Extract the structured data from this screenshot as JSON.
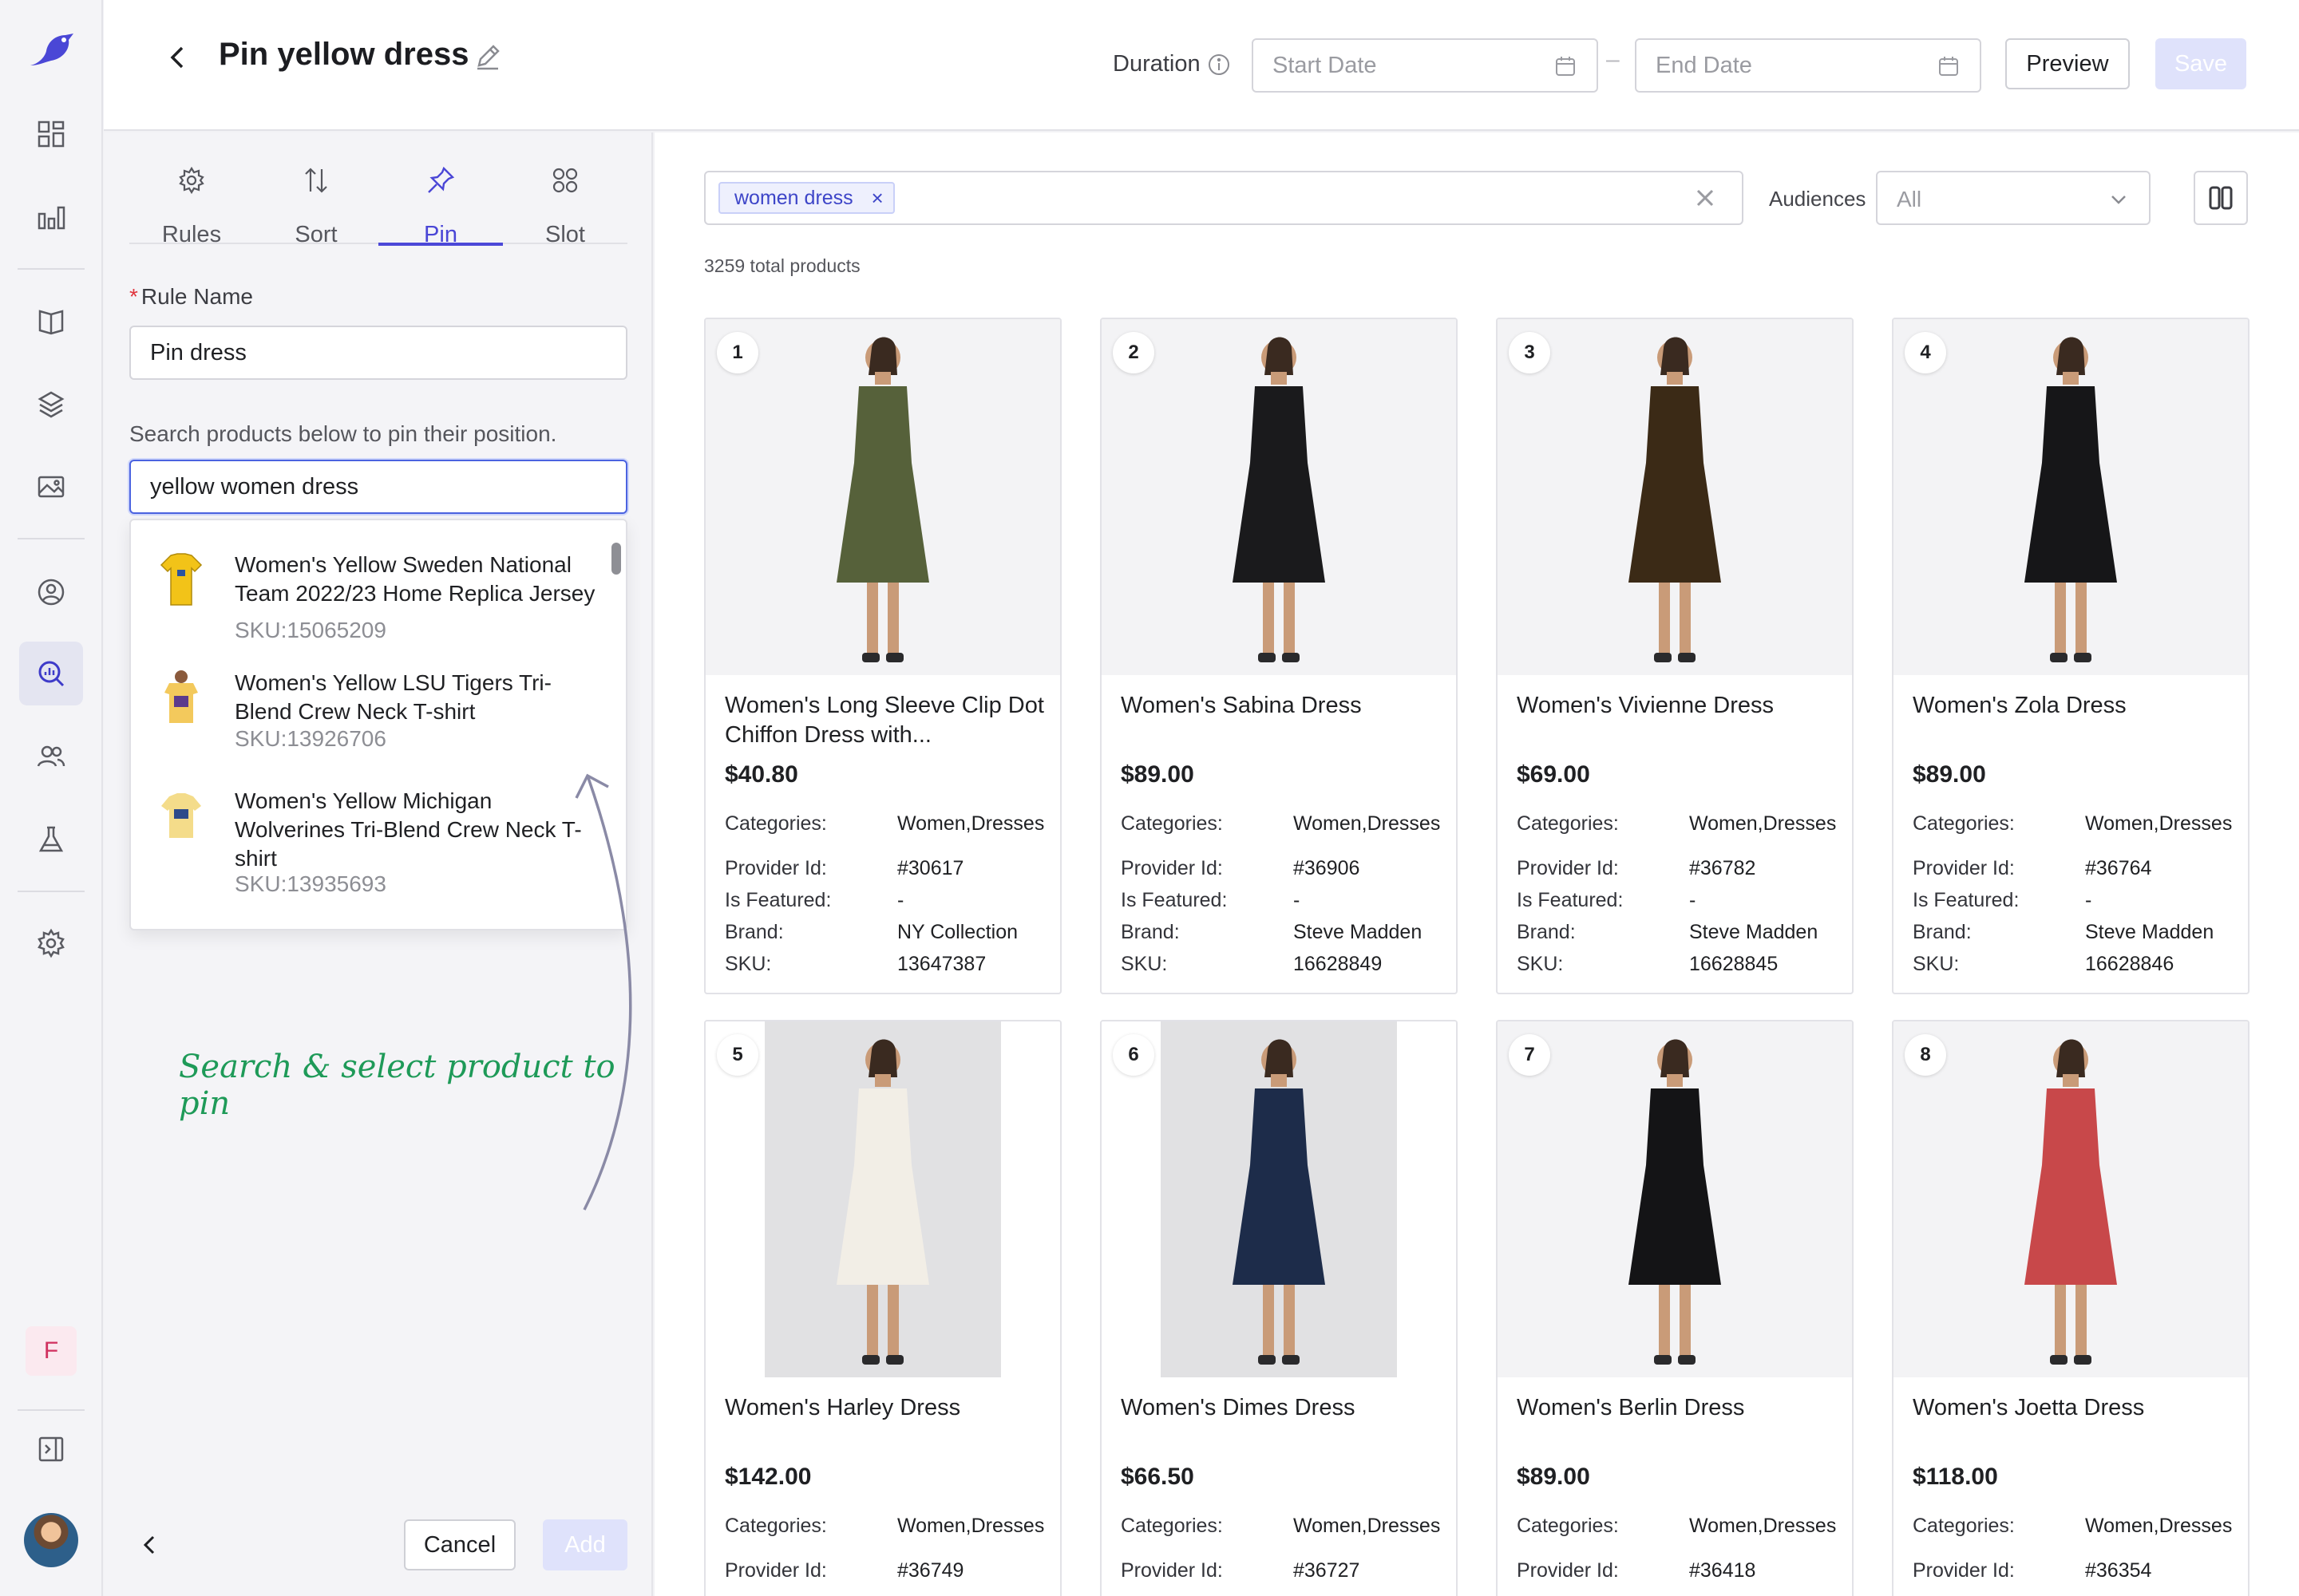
{
  "header": {
    "title": "Pin yellow dress",
    "duration_label": "Duration",
    "start_placeholder": "Start Date",
    "end_placeholder": "End Date",
    "dash": "–",
    "preview_label": "Preview",
    "save_label": "Save"
  },
  "rail": {
    "badge": "F",
    "icons": [
      "dashboard-icon",
      "analytics-icon",
      "catalog-icon",
      "layers-icon",
      "image-icon",
      "user-circle-icon",
      "search-insights-icon",
      "users-icon",
      "flask-icon",
      "gear-icon",
      "collapse-icon"
    ]
  },
  "panel": {
    "tabs": [
      {
        "label": "Rules",
        "icon": "gear-icon"
      },
      {
        "label": "Sort",
        "icon": "sort-icon"
      },
      {
        "label": "Pin",
        "icon": "pin-icon"
      },
      {
        "label": "Slot",
        "icon": "grid-icon"
      }
    ],
    "active_tab": "Pin",
    "rule_name_label": "Rule Name",
    "required_mark": "*",
    "rule_name_value": "Pin dress",
    "help_text": "Search products below to pin their position.",
    "search_value": "yellow women dress",
    "results": [
      {
        "name": "Women's Yellow Sweden National Team 2022/23 Home Replica Jersey",
        "sku": "SKU:15065209"
      },
      {
        "name": "Women's Yellow LSU Tigers Tri-Blend Crew Neck T-shirt",
        "sku": "SKU:13926706"
      },
      {
        "name": "Women's Yellow Michigan Wolverines Tri-Blend Crew Neck T-shirt",
        "sku": "SKU:13935693"
      }
    ],
    "annotation": "Search & select product to pin",
    "cancel_label": "Cancel",
    "add_label": "Add"
  },
  "main": {
    "tag": "women dress",
    "tag_remove": "×",
    "audiences_label": "Audiences",
    "audiences_value": "All",
    "total": "3259 total products",
    "field_labels": {
      "categories": "Categories:",
      "provider": "Provider Id:",
      "featured": "Is Featured:",
      "brand": "Brand:",
      "sku": "SKU:"
    },
    "products": [
      {
        "n": "1",
        "name": "Women's Long Sleeve Clip Dot Chiffon Dress with...",
        "price": "$40.80",
        "categories": "Women,Dresses",
        "provider": "#30617",
        "featured": "-",
        "brand": "NY Collection",
        "sku": "13647387",
        "color": "#56613a"
      },
      {
        "n": "2",
        "name": "Women's Sabina Dress",
        "price": "$89.00",
        "categories": "Women,Dresses",
        "provider": "#36906",
        "featured": "-",
        "brand": "Steve Madden",
        "sku": "16628849",
        "color": "#1a1a1c"
      },
      {
        "n": "3",
        "name": "Women's Vivienne Dress",
        "price": "$69.00",
        "categories": "Women,Dresses",
        "provider": "#36782",
        "featured": "-",
        "brand": "Steve Madden",
        "sku": "16628845",
        "color": "#3b2a16"
      },
      {
        "n": "4",
        "name": "Women's Zola Dress",
        "price": "$89.00",
        "categories": "Women,Dresses",
        "provider": "#36764",
        "featured": "-",
        "brand": "Steve Madden",
        "sku": "16628846",
        "color": "#161618"
      },
      {
        "n": "5",
        "name": "Women's Harley Dress",
        "price": "$142.00",
        "categories": "Women,Dresses",
        "provider": "#36749",
        "color": "#f2eee6"
      },
      {
        "n": "6",
        "name": "Women's Dimes Dress",
        "price": "$66.50",
        "categories": "Women,Dresses",
        "provider": "#36727",
        "color": "#1d2c4a"
      },
      {
        "n": "7",
        "name": "Women's Berlin Dress",
        "price": "$89.00",
        "categories": "Women,Dresses",
        "provider": "#36418",
        "color": "#141416"
      },
      {
        "n": "8",
        "name": "Women's Joetta Dress",
        "price": "$118.00",
        "categories": "Women,Dresses",
        "provider": "#36354",
        "color": "#c8484a"
      }
    ]
  }
}
